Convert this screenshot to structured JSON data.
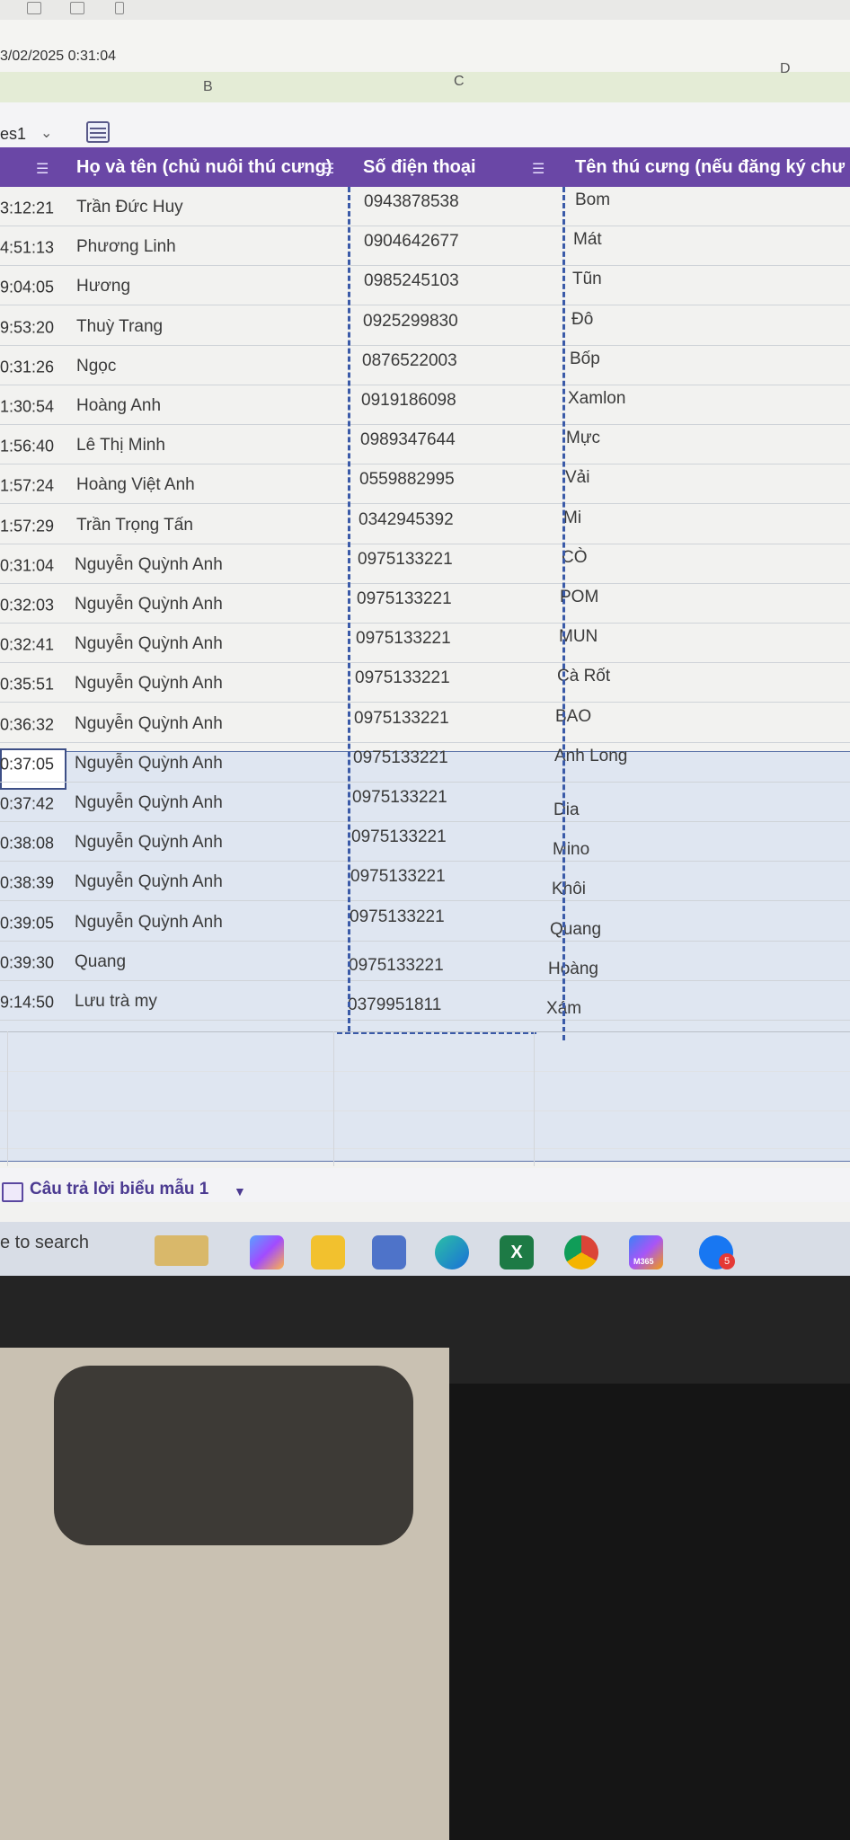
{
  "formula_bar": {
    "timestamp": "3/02/2025 0:31:04"
  },
  "column_letters": [
    "B",
    "C",
    "D"
  ],
  "sheet": {
    "name": "es1"
  },
  "table": {
    "headers": [
      "Họ và tên (chủ nuôi thú cưng)",
      "Số điện thoại",
      "Tên thú cưng (nếu đăng ký chư"
    ],
    "rows": [
      {
        "time": "3:12:21",
        "name": "Trần Đức Huy",
        "phone": "0943878538",
        "pet": "Bom"
      },
      {
        "time": "4:51:13",
        "name": "Phương Linh",
        "phone": "0904642677",
        "pet": "Mát"
      },
      {
        "time": "9:04:05",
        "name": "Hương",
        "phone": "0985245103",
        "pet": "Tũn"
      },
      {
        "time": "9:53:20",
        "name": "Thuỳ Trang",
        "phone": "0925299830",
        "pet": "Đô"
      },
      {
        "time": "0:31:26",
        "name": "Ngọc",
        "phone": "0876522003",
        "pet": "Bốp"
      },
      {
        "time": "1:30:54",
        "name": "Hoàng Anh",
        "phone": "0919186098",
        "pet": "Xamlon"
      },
      {
        "time": "1:56:40",
        "name": "Lê Thị Minh",
        "phone": "0989347644",
        "pet": "Mực"
      },
      {
        "time": "1:57:24",
        "name": "Hoàng Việt Anh",
        "phone": "0559882995",
        "pet": "Vải"
      },
      {
        "time": "1:57:29",
        "name": "Trần Trọng Tấn",
        "phone": "0342945392",
        "pet": "Mi"
      },
      {
        "time": "0:31:04",
        "name": "Nguyễn Quỳnh Anh",
        "phone": "0975133221",
        "pet": "CÒ"
      },
      {
        "time": "0:32:03",
        "name": "Nguyễn Quỳnh Anh",
        "phone": "0975133221",
        "pet": "POM"
      },
      {
        "time": "0:32:41",
        "name": "Nguyễn Quỳnh Anh",
        "phone": "0975133221",
        "pet": "MUN"
      },
      {
        "time": "0:35:51",
        "name": "Nguyễn Quỳnh Anh",
        "phone": "0975133221",
        "pet": "Cà Rốt"
      },
      {
        "time": "0:36:32",
        "name": "Nguyễn Quỳnh Anh",
        "phone": "0975133221",
        "pet": "BAO"
      },
      {
        "time": "0:37:05",
        "name": "Nguyễn Quỳnh Anh",
        "phone": "0975133221",
        "pet": "Anh Long"
      },
      {
        "time": "0:37:42",
        "name": "Nguyễn Quỳnh Anh",
        "phone": "0975133221",
        "pet": "Dia"
      },
      {
        "time": "0:38:08",
        "name": "Nguyễn Quỳnh Anh",
        "phone": "0975133221",
        "pet": "Mino"
      },
      {
        "time": "0:38:39",
        "name": "Nguyễn Quỳnh Anh",
        "phone": "0975133221",
        "pet": "Khôi"
      },
      {
        "time": "0:39:05",
        "name": "Nguyễn Quỳnh Anh",
        "phone": "0975133221",
        "pet": "Quang"
      },
      {
        "time": "0:39:30",
        "name": "Quang",
        "phone": "0975133221",
        "pet": "Hoàng"
      },
      {
        "time": "9:14:50",
        "name": "Lưu trà my",
        "phone": "0379951811",
        "pet": "Xám"
      }
    ]
  },
  "sheet_tab": {
    "label": "Câu trả lời biểu mẫu 1"
  },
  "taskbar": {
    "search_text": "e to search",
    "apps": [
      "copilot-icon",
      "file-explorer-icon",
      "store-icon",
      "edge-icon",
      "excel-icon",
      "chrome-icon",
      "m365-icon",
      "zalo-icon"
    ],
    "m365_label": "M365",
    "badge_count": "5"
  }
}
